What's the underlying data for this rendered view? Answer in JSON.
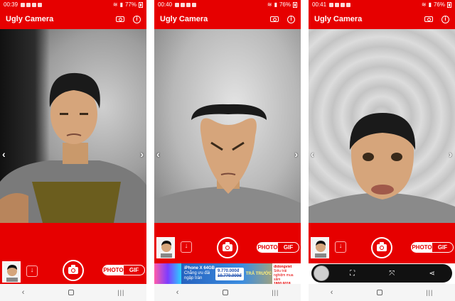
{
  "app": {
    "title": "Ugly Camera"
  },
  "screens": [
    {
      "status": {
        "time": "00:39",
        "battery": "77%"
      },
      "mode": {
        "photo": "PHOTO",
        "gif": "GIF",
        "selected": "PHOTO"
      },
      "ad": null
    },
    {
      "status": {
        "time": "00:40",
        "battery": "76%"
      },
      "mode": {
        "photo": "PHOTO",
        "gif": "GIF",
        "selected": "PHOTO"
      },
      "ad": {
        "type": "banner",
        "product": "iPhone X 64GB",
        "subtitle": "Chẳng ưu đãi ngập tràn",
        "price": "9.770.000đ",
        "old_price": "10.770.000đ",
        "tag": "TRẢ TRƯỚC",
        "store": "didongviet",
        "store_text": "Siêu trải nghiệm mua sắm",
        "phone": "1800.6018"
      }
    },
    {
      "status": {
        "time": "00:41",
        "battery": "76%"
      },
      "mode": {
        "photo": "PHOTO",
        "gif": "GIF",
        "selected": "PHOTO"
      },
      "ad": {
        "type": "toolbar",
        "icons": [
          "avatar-icon",
          "scan-icon",
          "crop-icon",
          "share-icon"
        ]
      }
    }
  ],
  "nav": {
    "back": "‹",
    "recent": "|||"
  },
  "colors": {
    "accent": "#e60000",
    "white": "#ffffff"
  }
}
